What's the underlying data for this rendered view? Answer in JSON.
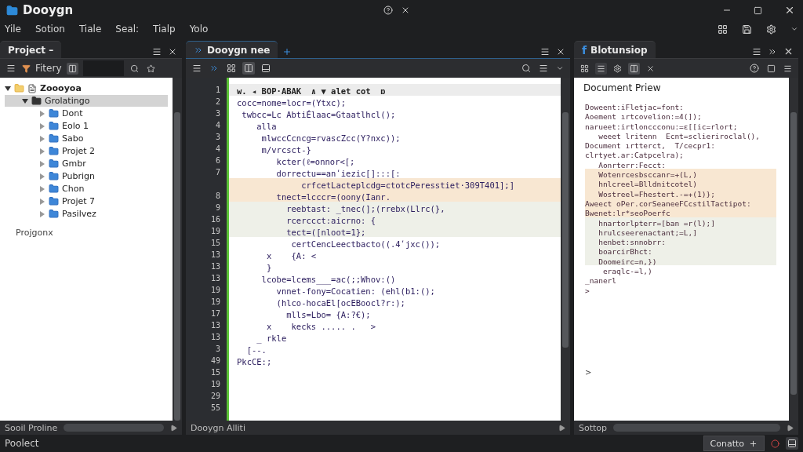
{
  "window": {
    "title": "Dooygn"
  },
  "menu": [
    "Yile",
    "Sotion",
    "Tiale",
    "Seal:",
    "Tialp",
    "Yolo"
  ],
  "project_panel": {
    "tab": "Project –",
    "filter": "Fitery",
    "tree": [
      {
        "label": "Zoooyoa",
        "expanded": true,
        "selected": false,
        "children": [
          {
            "label": "Grolatingo",
            "expanded": true,
            "selected": true,
            "children": [
              {
                "label": "Dont",
                "expanded": false,
                "selected": false
              },
              {
                "label": "Eolo 1",
                "expanded": false,
                "selected": false
              },
              {
                "label": "Sabo",
                "expanded": false,
                "selected": false
              },
              {
                "label": "Projet 2",
                "expanded": false,
                "selected": false
              },
              {
                "label": "Gmbr",
                "expanded": false,
                "selected": false
              },
              {
                "label": "Pubrign",
                "expanded": false,
                "selected": false
              },
              {
                "label": "Chon",
                "expanded": false,
                "selected": false
              },
              {
                "label": "Projet 7",
                "expanded": false,
                "selected": false
              },
              {
                "label": "Pasilvez",
                "expanded": false,
                "selected": false
              }
            ]
          }
        ]
      }
    ],
    "footer_label": "Projgonx",
    "bottom_label": "Sooil Proline"
  },
  "editor": {
    "tab": "Dooygn nee",
    "bottom_label": "Dooygn Alliti",
    "lines": [
      {
        "number": "1",
        "text": "w. ◂ BOP·ABAK  ∧ ▼ alet cot  ɒ",
        "color": "#ececec"
      },
      {
        "number": "2",
        "text": "cocc=nome=locr=(Ytxc);"
      },
      {
        "number": "3",
        "text": " twbcc=Lc AbtiÉlaac=Gtaatlhcl();"
      },
      {
        "number": "4",
        "text": "    alla"
      },
      {
        "number": "3",
        "text": "     mlwccCcncg=rvascZcc(Y?nxc));"
      },
      {
        "number": "4",
        "text": "     m/vrcsct-}"
      },
      {
        "number": "6",
        "text": "        kcter(ℓ=onnor<[;"
      },
      {
        "number": "7",
        "text": "        dorrectu==anʹiezic[]:::[:"
      },
      {
        "text": "             crfcetLacteplcdg=ctotcPeresstiet·309T401];]",
        "color": "#f8e7d2"
      },
      {
        "number": "8",
        "text": "        tnect=lcccr=(oony(Ianr.",
        "color": "#f8e7d2"
      },
      {
        "number": "9",
        "text": "          reebtast: _tnec(];(rrebx(Llrc(},",
        "color": "#eef0e8"
      },
      {
        "number": "16",
        "text": "          rcerccct:aicrno: {",
        "color": "#eef0e8"
      },
      {
        "number": "19",
        "text": "          tect=([nloot=1};",
        "color": "#eef0e8"
      },
      {
        "number": "15",
        "text": "           certCencLeectbacto((.4ʹjxc());"
      },
      {
        "number": "13",
        "text": "      x    {A: <"
      },
      {
        "number": "13",
        "text": "      }"
      },
      {
        "number": "13",
        "text": "     lcobe=lcems___=ac(;;Whov:()"
      },
      {
        "number": "19",
        "text": "        vnnet-fony=Cocatien: (ehl(b1:();"
      },
      {
        "number": "19",
        "text": "        (hlco-hocaEl[ocEBoocl?r:);"
      },
      {
        "number": "17",
        "text": "          mlls=Lbo= {A:?€);"
      },
      {
        "number": "13",
        "text": "      x    kecks ..... .   >"
      },
      {
        "number": "13",
        "text": "    _ rkle"
      },
      {
        "number": "3",
        "text": "  [--."
      },
      {
        "number": "49",
        "text": "PkcCE:;"
      },
      {
        "number": "15"
      },
      {
        "number": "19"
      },
      {
        "number": "29"
      },
      {
        "number": "55"
      }
    ]
  },
  "preview": {
    "tab_icon": "f",
    "tab": "Blotunsiop",
    "title": "Document Priew",
    "bottom_label": "Sottop",
    "lines": [
      {
        "text": "Doweent:iFletjac=font:"
      },
      {
        "text": "Aoement ırtcovelion:=4(]);"
      },
      {
        "text": "narueet:irtlonccconu:=ɛ[[ic=rlort;"
      },
      {
        "text": "   weeet lritenn  Ecnt=sclieriroclal(),"
      },
      {
        "text": "Document ırtterct,  T/cecpr1:"
      },
      {
        "text": "clrtyet.ar:Catpcelra);"
      },
      {
        "text": "   Aonrterr:Fecct:"
      },
      {
        "text": "   Wotenrcesbsccanr=+(L,)",
        "color": "#f8e7d2"
      },
      {
        "text": "   hnlcreel=Blldnitcotel)",
        "color": "#f8e7d2"
      },
      {
        "text": "   Wostreel=Fhestert.-=+(1)};",
        "color": "#f8e7d2"
      },
      {
        "text": "Aweect oPer.corSeaneeFCcstilTactipot:",
        "color": "#f8e7d2"
      },
      {
        "text": "Bwenet:lr*seoPoerfc",
        "color": "#f8e7d2"
      },
      {
        "text": "   hnartorlpterr=[ban =r(l);]",
        "color": "#eef0e8"
      },
      {
        "text": "   hrulcseerenactant;=L,]",
        "color": "#eef0e8"
      },
      {
        "text": "   henbet:snnobrr:",
        "color": "#eef0e8"
      },
      {
        "text": "   boarcirBhct:",
        "color": "#eef0e8"
      },
      {
        "text": "   Doomeirc=n,})",
        "color": "#eef0e8"
      },
      {
        "text": "    eraqlc-=l,)"
      },
      {
        "text": "_nanerl"
      },
      {
        "text": ">"
      }
    ],
    "end_mark": ">"
  },
  "status_bar": {
    "label": "Poolect",
    "button": "Conatto"
  }
}
